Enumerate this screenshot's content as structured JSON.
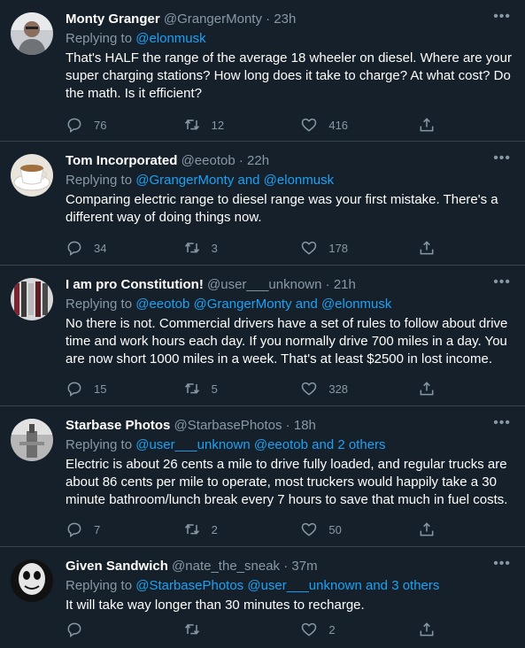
{
  "tweets": [
    {
      "name": "Monty Granger",
      "handle": "@GrangerMonty",
      "time": "23h",
      "replying_prefix": "Replying to ",
      "replying_to": "@elonmusk",
      "text": "That's HALF the range of the average 18 wheeler on diesel. Where are your super charging stations? How long does it take to charge? At what cost? Do the math. Is it efficient?",
      "replies": "76",
      "retweets": "12",
      "likes": "416"
    },
    {
      "name": "Tom Incorporated",
      "handle": "@eeotob",
      "time": "22h",
      "replying_prefix": "Replying to ",
      "replying_to": "@GrangerMonty and @elonmusk",
      "text": "Comparing electric range to diesel range was your first mistake. There's a different way of doing things now.",
      "replies": "34",
      "retweets": "3",
      "likes": "178"
    },
    {
      "name": "I am pro Constitution!",
      "handle": "@user___unknown",
      "time": "21h",
      "replying_prefix": "Replying to ",
      "replying_to": "@eeotob @GrangerMonty and @elonmusk",
      "text": "No there is not. Commercial drivers have a set of rules to follow about drive time and work hours each day. If you normally drive 700 miles in a day. You are now short 1000 miles in a week. That's at least $2500 in lost income.",
      "replies": "15",
      "retweets": "5",
      "likes": "328"
    },
    {
      "name": "Starbase Photos",
      "handle": "@StarbasePhotos",
      "time": "18h",
      "replying_prefix": "Replying to ",
      "replying_to": "@user___unknown @eeotob and 2 others",
      "text": "Electric is about 26 cents a mile to drive fully loaded, and regular trucks are about 86 cents per mile to operate, most truckers would happily take a 30 minute bathroom/lunch break every 7 hours to save that much in fuel costs.",
      "replies": "7",
      "retweets": "2",
      "likes": "50"
    },
    {
      "name": "Given Sandwich",
      "handle": "@nate_the_sneak",
      "time": "37m",
      "replying_prefix": "Replying to ",
      "replying_to": "@StarbasePhotos @user___unknown and 3 others",
      "text": "It will take way longer than 30 minutes to recharge.",
      "replies": "",
      "retweets": "",
      "likes": "2"
    }
  ],
  "separator": " · ",
  "more_glyph": "•••",
  "colors": {
    "background": "#15202b",
    "link": "#1da1f2",
    "muted": "#8899a6",
    "divider": "#38444d"
  },
  "icons": [
    "reply-icon",
    "retweet-icon",
    "like-icon",
    "share-icon",
    "more-icon"
  ]
}
